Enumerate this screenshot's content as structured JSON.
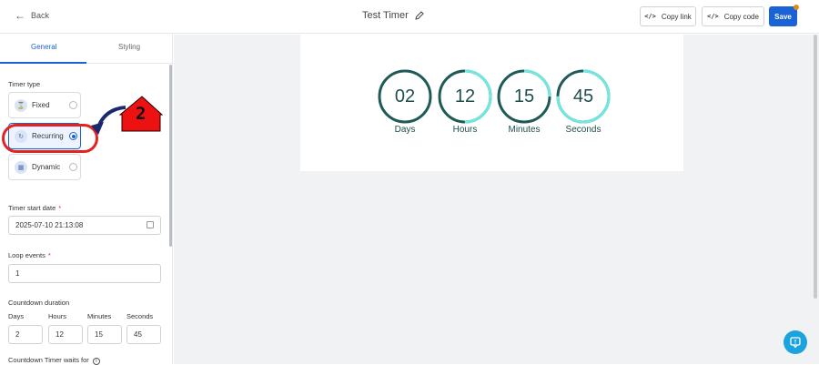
{
  "topbar": {
    "back_label": "Back",
    "title": "Test Timer",
    "copy_link_label": "Copy link",
    "copy_code_label": "Copy code",
    "save_label": "Save"
  },
  "tabs": {
    "general": "General",
    "styling": "Styling"
  },
  "timer_type": {
    "label": "Timer type",
    "options": [
      {
        "label": "Fixed",
        "selected": false
      },
      {
        "label": "Recurring",
        "selected": true
      },
      {
        "label": "Dynamic",
        "selected": false
      }
    ]
  },
  "timer_start_date": {
    "label": "Timer start date",
    "required_mark": "*",
    "value": "2025-07-10 21:13:08"
  },
  "loop_events": {
    "label": "Loop events",
    "required_mark": "*",
    "value": "1"
  },
  "countdown_duration": {
    "label": "Countdown duration",
    "fields": [
      {
        "label": "Days",
        "value": "2"
      },
      {
        "label": "Hours",
        "value": "12"
      },
      {
        "label": "Minutes",
        "value": "15"
      },
      {
        "label": "Seconds",
        "value": "45"
      }
    ]
  },
  "waits_for": {
    "label": "Countdown Timer waits for"
  },
  "annotation": {
    "step": "2"
  },
  "preview": {
    "units": [
      {
        "value": "02",
        "label": "Days",
        "fraction": 0.0
      },
      {
        "value": "12",
        "label": "Hours",
        "fraction": 0.5
      },
      {
        "value": "15",
        "label": "Minutes",
        "fraction": 0.25
      },
      {
        "value": "45",
        "label": "Seconds",
        "fraction": 0.75
      }
    ],
    "colors": {
      "elapsed": "#1f5a57",
      "remaining": "#72e7df"
    }
  }
}
